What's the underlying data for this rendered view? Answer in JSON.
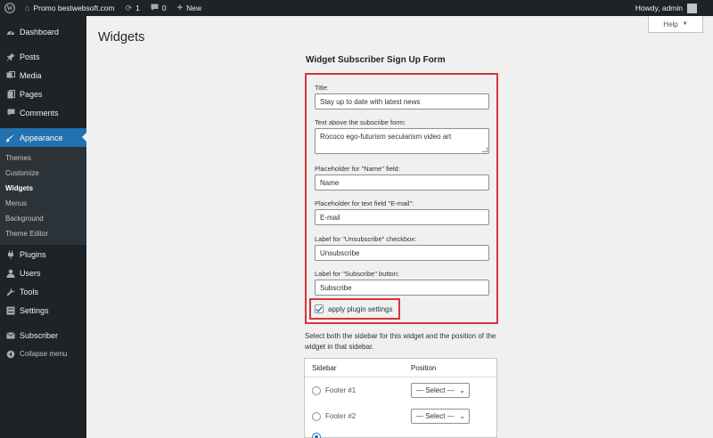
{
  "adminbar": {
    "site_name": "Promo bestwebsoft.com",
    "updates_count": "1",
    "comments_count": "0",
    "new_label": "New",
    "howdy": "Howdy, admin"
  },
  "sidebar": {
    "dashboard": "Dashboard",
    "posts": "Posts",
    "media": "Media",
    "pages": "Pages",
    "comments": "Comments",
    "appearance": "Appearance",
    "submenu": {
      "themes": "Themes",
      "customize": "Customize",
      "widgets": "Widgets",
      "menus": "Menus",
      "background": "Background",
      "theme_editor": "Theme Editor"
    },
    "plugins": "Plugins",
    "users": "Users",
    "tools": "Tools",
    "settings": "Settings",
    "subscriber": "Subscriber",
    "collapse": "Collapse menu"
  },
  "page": {
    "title": "Widgets",
    "help": "Help"
  },
  "widget": {
    "heading": "Widget Subscriber Sign Up Form",
    "title_label": "Title:",
    "title_value": "Stay up to date with latest news",
    "text_label": "Text above the subscribe form:",
    "text_value": "Rococo ego-futurism secularism video art",
    "name_ph_label": "Placeholder for \"Name\" field:",
    "name_ph_value": "Name",
    "email_ph_label": "Placeholder for text field \"E-mail\":",
    "email_ph_value": "E-mail",
    "unsub_label": "Label for \"Unsubscribe\" checkbox:",
    "unsub_value": "Unsubscribe",
    "sub_label": "Label for \"Subscribe\" button:",
    "sub_value": "Subscribe",
    "apply_label": "apply plugin settings",
    "apply_checked": true
  },
  "chooser": {
    "description": "Select both the sidebar for this widget and the position of the widget in that sidebar.",
    "col_sidebar": "Sidebar",
    "col_position": "Position",
    "rows": [
      {
        "name": "Footer #1",
        "position": "— Select —"
      },
      {
        "name": "Footer #2",
        "position": "— Select —"
      }
    ]
  }
}
